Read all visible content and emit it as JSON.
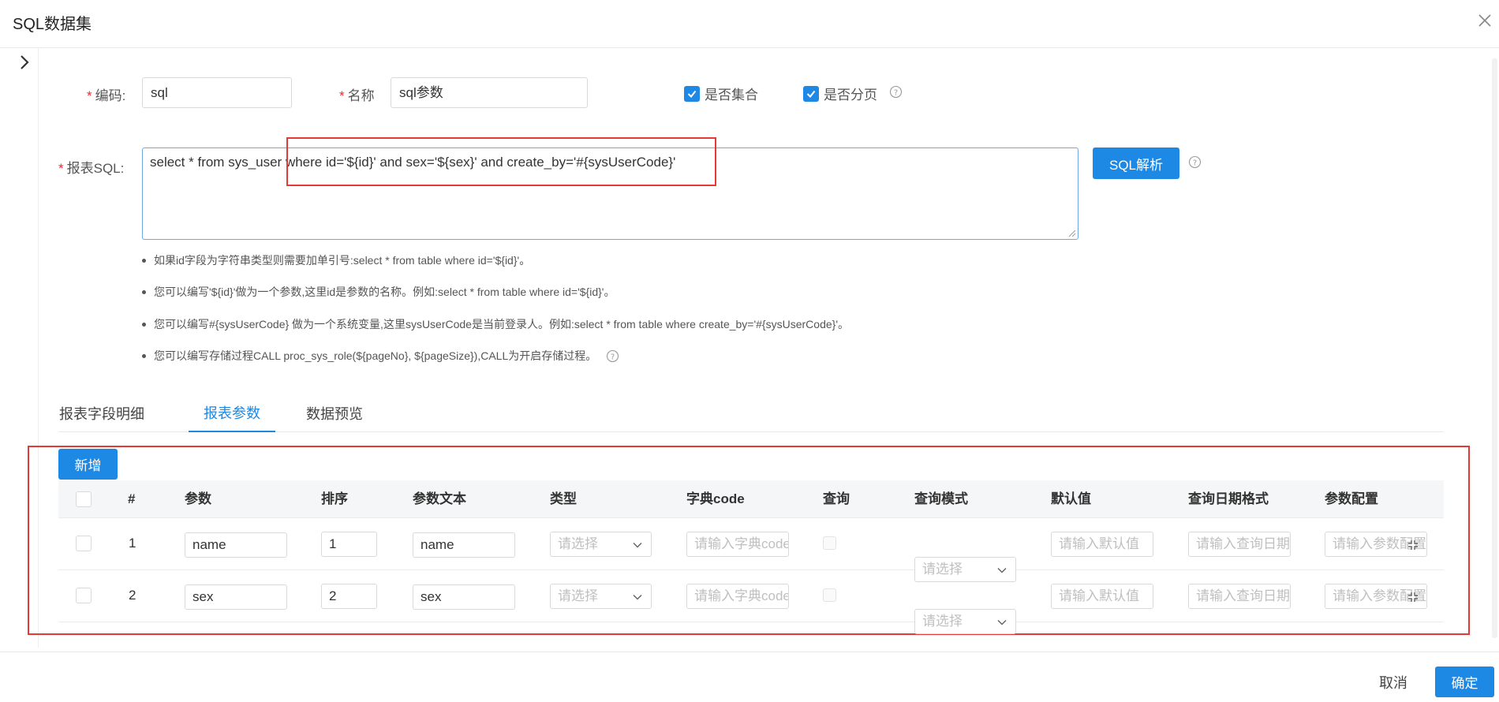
{
  "modal": {
    "title": "SQL数据集"
  },
  "form": {
    "code": {
      "label": "编码:",
      "value": "sql"
    },
    "name": {
      "label": "名称",
      "value": "sql参数"
    },
    "is_collection": {
      "label": "是否集合",
      "checked": true
    },
    "is_paging": {
      "label": "是否分页",
      "checked": true
    },
    "sql": {
      "label": "报表SQL:",
      "value": "select * from sys_user where id='${id}' and sex='${sex}' and  create_by='#{sysUserCode}'"
    },
    "parse_button": "SQL解析"
  },
  "tips": [
    "如果id字段为字符串类型则需要加单引号:select * from table where id='${id}'。",
    "您可以编写'${id}'做为一个参数,这里id是参数的名称。例如:select * from table where id='${id}'。",
    "您可以编写#{sysUserCode} 做为一个系统变量,这里sysUserCode是当前登录人。例如:select * from table where create_by='#{sysUserCode}'。",
    "您可以编写存储过程CALL proc_sys_role(${pageNo}, ${pageSize}),CALL为开启存储过程。"
  ],
  "tabs": [
    {
      "label": "报表字段明细",
      "active": false
    },
    {
      "label": "报表参数",
      "active": true
    },
    {
      "label": "数据预览",
      "active": false
    }
  ],
  "params_table": {
    "add_button": "新增",
    "headers": [
      "#",
      "参数",
      "排序",
      "参数文本",
      "类型",
      "字典code",
      "查询",
      "查询模式",
      "默认值",
      "查询日期格式",
      "参数配置"
    ],
    "rows": [
      {
        "index": "1",
        "param": "name",
        "order": "1",
        "text": "name"
      },
      {
        "index": "2",
        "param": "sex",
        "order": "2",
        "text": "sex"
      }
    ],
    "placeholders": {
      "type": "请选择",
      "dict_code": "请输入字典code",
      "query_mode": "请选择",
      "default_value": "请输入默认值",
      "date_format": "请输入查询日期格式",
      "param_config": "请输入参数配置"
    }
  },
  "footer": {
    "cancel": "取消",
    "confirm": "确定"
  },
  "colors": {
    "primary": "#1e88e5",
    "highlight": "#e53935",
    "required": "#f5222d"
  }
}
